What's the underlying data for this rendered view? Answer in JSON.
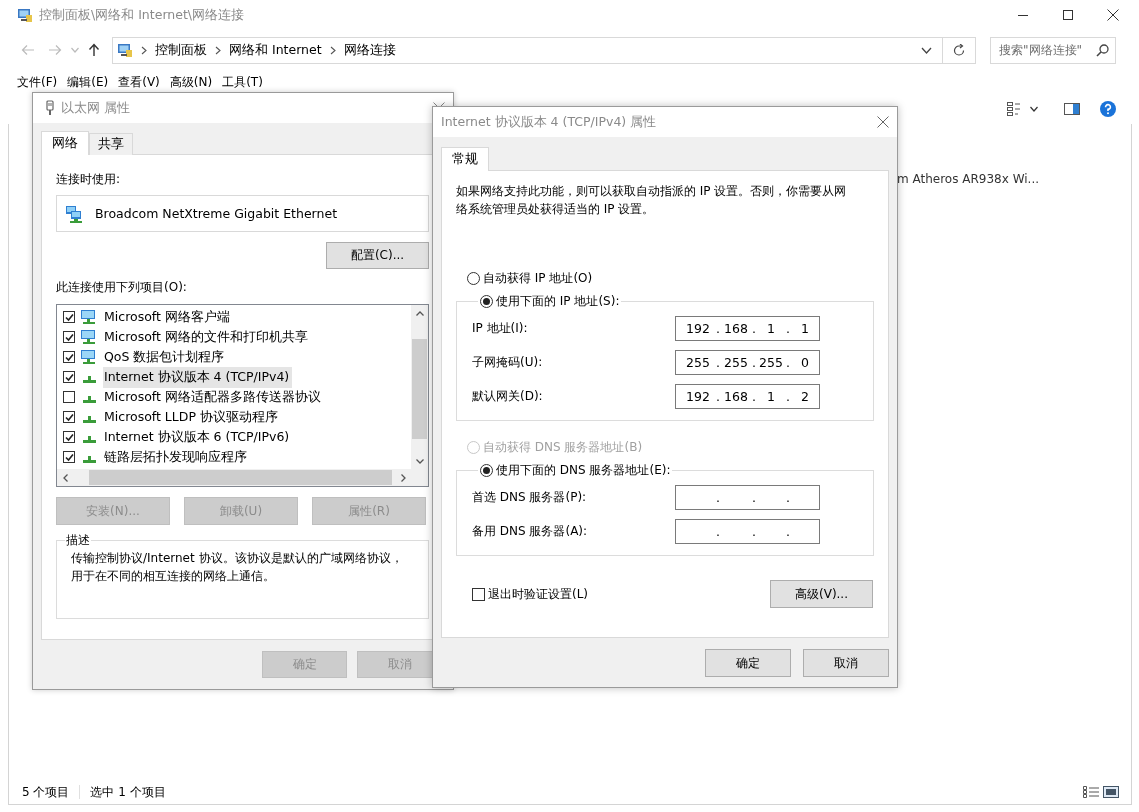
{
  "explorer": {
    "title": "控制面板\\网络和 Internet\\网络连接",
    "breadcrumb": [
      "控制面板",
      "网络和 Internet",
      "网络连接"
    ],
    "search": {
      "placeholder": "搜索\"网络连接\""
    },
    "menu": [
      "文件(F)",
      "编辑(E)",
      "查看(V)",
      "高级(N)",
      "工具(T)"
    ],
    "items": [
      "m Atheros AR938x Wi..."
    ],
    "status_bar": [
      "5 个项目",
      "选中 1 个项目"
    ]
  },
  "ethernet_dialog": {
    "title": "以太网 属性",
    "tabs": [
      {
        "label": "网络",
        "selected": true
      },
      {
        "label": "共享",
        "selected": false
      }
    ],
    "connect_using_label": "连接时使用:",
    "adapter": "Broadcom NetXtreme Gigabit Ethernet",
    "configure_button": "配置(C)...",
    "items_label": "此连接使用下列项目(O):",
    "items": [
      {
        "label": "Microsoft 网络客户端",
        "kind": "client",
        "checked": true,
        "selected": false
      },
      {
        "label": "Microsoft 网络的文件和打印机共享",
        "kind": "client",
        "checked": true,
        "selected": false
      },
      {
        "label": "QoS 数据包计划程序",
        "kind": "client",
        "checked": true,
        "selected": false
      },
      {
        "label": "Internet 协议版本 4 (TCP/IPv4)",
        "kind": "protocol",
        "checked": true,
        "selected": true
      },
      {
        "label": "Microsoft 网络适配器多路传送器协议",
        "kind": "protocol",
        "checked": false,
        "selected": false
      },
      {
        "label": "Microsoft LLDP 协议驱动程序",
        "kind": "protocol",
        "checked": true,
        "selected": false
      },
      {
        "label": "Internet 协议版本 6 (TCP/IPv6)",
        "kind": "protocol",
        "checked": true,
        "selected": false
      },
      {
        "label": "链路层拓扑发现响应程序",
        "kind": "protocol",
        "checked": true,
        "selected": false
      }
    ],
    "actions": [
      {
        "label": "安装(N)...",
        "disabled": true
      },
      {
        "label": "卸载(U)",
        "disabled": true
      },
      {
        "label": "属性(R)",
        "disabled": true
      }
    ],
    "description_label": "描述",
    "description": "传输控制协议/Internet 协议。该协议是默认的广域网络协议，用于在不同的相互连接的网络上通信。",
    "buttons": [
      {
        "label": "确定",
        "disabled": true
      },
      {
        "label": "取消",
        "disabled": true
      }
    ]
  },
  "ipv4_dialog": {
    "title": "Internet 协议版本 4 (TCP/IPv4) 属性",
    "tabs": [
      {
        "label": "常规",
        "selected": true
      }
    ],
    "intro": "如果网络支持此功能，则可以获取自动指派的 IP 设置。否则，你需要从网络系统管理员处获得适当的 IP 设置。",
    "ip_options": [
      {
        "label": "自动获得 IP 地址(O)",
        "selected": false,
        "disabled": false
      },
      {
        "label": "使用下面的 IP 地址(S):",
        "selected": true,
        "disabled": false
      }
    ],
    "ip_fields": [
      {
        "label": "IP 地址(I):",
        "segments": [
          "192",
          ".",
          "168",
          ".",
          "1",
          ".",
          "1"
        ]
      },
      {
        "label": "子网掩码(U):",
        "segments": [
          "255",
          ".",
          "255",
          ".",
          "255",
          ".",
          "0"
        ]
      },
      {
        "label": "默认网关(D):",
        "segments": [
          "192",
          ".",
          "168",
          ".",
          "1",
          ".",
          "2"
        ]
      }
    ],
    "dns_options": [
      {
        "label": "自动获得 DNS 服务器地址(B)",
        "selected": false,
        "disabled": true
      },
      {
        "label": "使用下面的 DNS 服务器地址(E):",
        "selected": true,
        "disabled": false
      }
    ],
    "dns_fields": [
      {
        "label": "首选 DNS 服务器(P):",
        "segments": [
          ".",
          ".",
          "."
        ]
      },
      {
        "label": "备用 DNS 服务器(A):",
        "segments": [
          ".",
          ".",
          "."
        ]
      }
    ],
    "validate_checkbox": {
      "label": "退出时验证设置(L)",
      "checked": false
    },
    "advanced_button": "高级(V)...",
    "buttons": [
      {
        "label": "确定",
        "disabled": false
      },
      {
        "label": "取消",
        "disabled": false
      }
    ]
  }
}
